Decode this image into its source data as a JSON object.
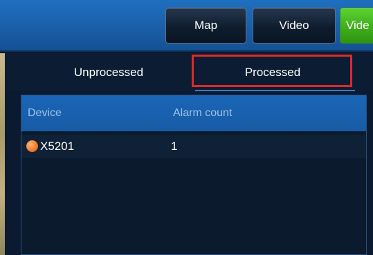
{
  "toolbar": {
    "map_label": "Map",
    "video_label": "Video",
    "video2_label": "Vide"
  },
  "tabs": [
    {
      "label": "Unprocessed",
      "active": false
    },
    {
      "label": "Processed",
      "active": true
    }
  ],
  "table": {
    "headers": [
      "Device",
      "Alarm count"
    ],
    "rows": [
      {
        "device": "X5201",
        "alarm_count": "1",
        "status_icon": "orange-dot-icon",
        "status_color": "#ef7a2a"
      }
    ]
  },
  "colors": {
    "header_blue": "#1a5fa8",
    "green_button": "#3fae1c",
    "highlight_red": "#e02828"
  }
}
